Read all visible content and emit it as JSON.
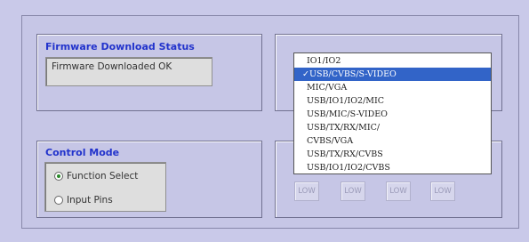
{
  "firmware": {
    "title": "Firmware Download Status",
    "status_value": "Firmware Downloaded OK"
  },
  "control_mode": {
    "title": "Control Mode",
    "options": [
      {
        "label": "Function Select",
        "checked": true
      },
      {
        "label": "Input Pins",
        "checked": false
      }
    ]
  },
  "pins": {
    "buttons": [
      "LOW",
      "LOW",
      "LOW",
      "LOW"
    ]
  },
  "dropdown": {
    "check_glyph": "✓",
    "options": [
      "IO1/IO2",
      "USB/CVBS/S-VIDEO",
      "MIC/VGA",
      "USB/IO1/IO2/MIC",
      "USB/MIC/S-VIDEO",
      "USB/TX/RX/MIC/",
      "CVBS/VGA",
      "USB/TX/RX/CVBS",
      "USB/IO1/IO2/CVBS"
    ],
    "selected_index": 1
  },
  "colors": {
    "background": "#c9c9e9",
    "group_title": "#2233cc",
    "selection": "#3264c8"
  }
}
